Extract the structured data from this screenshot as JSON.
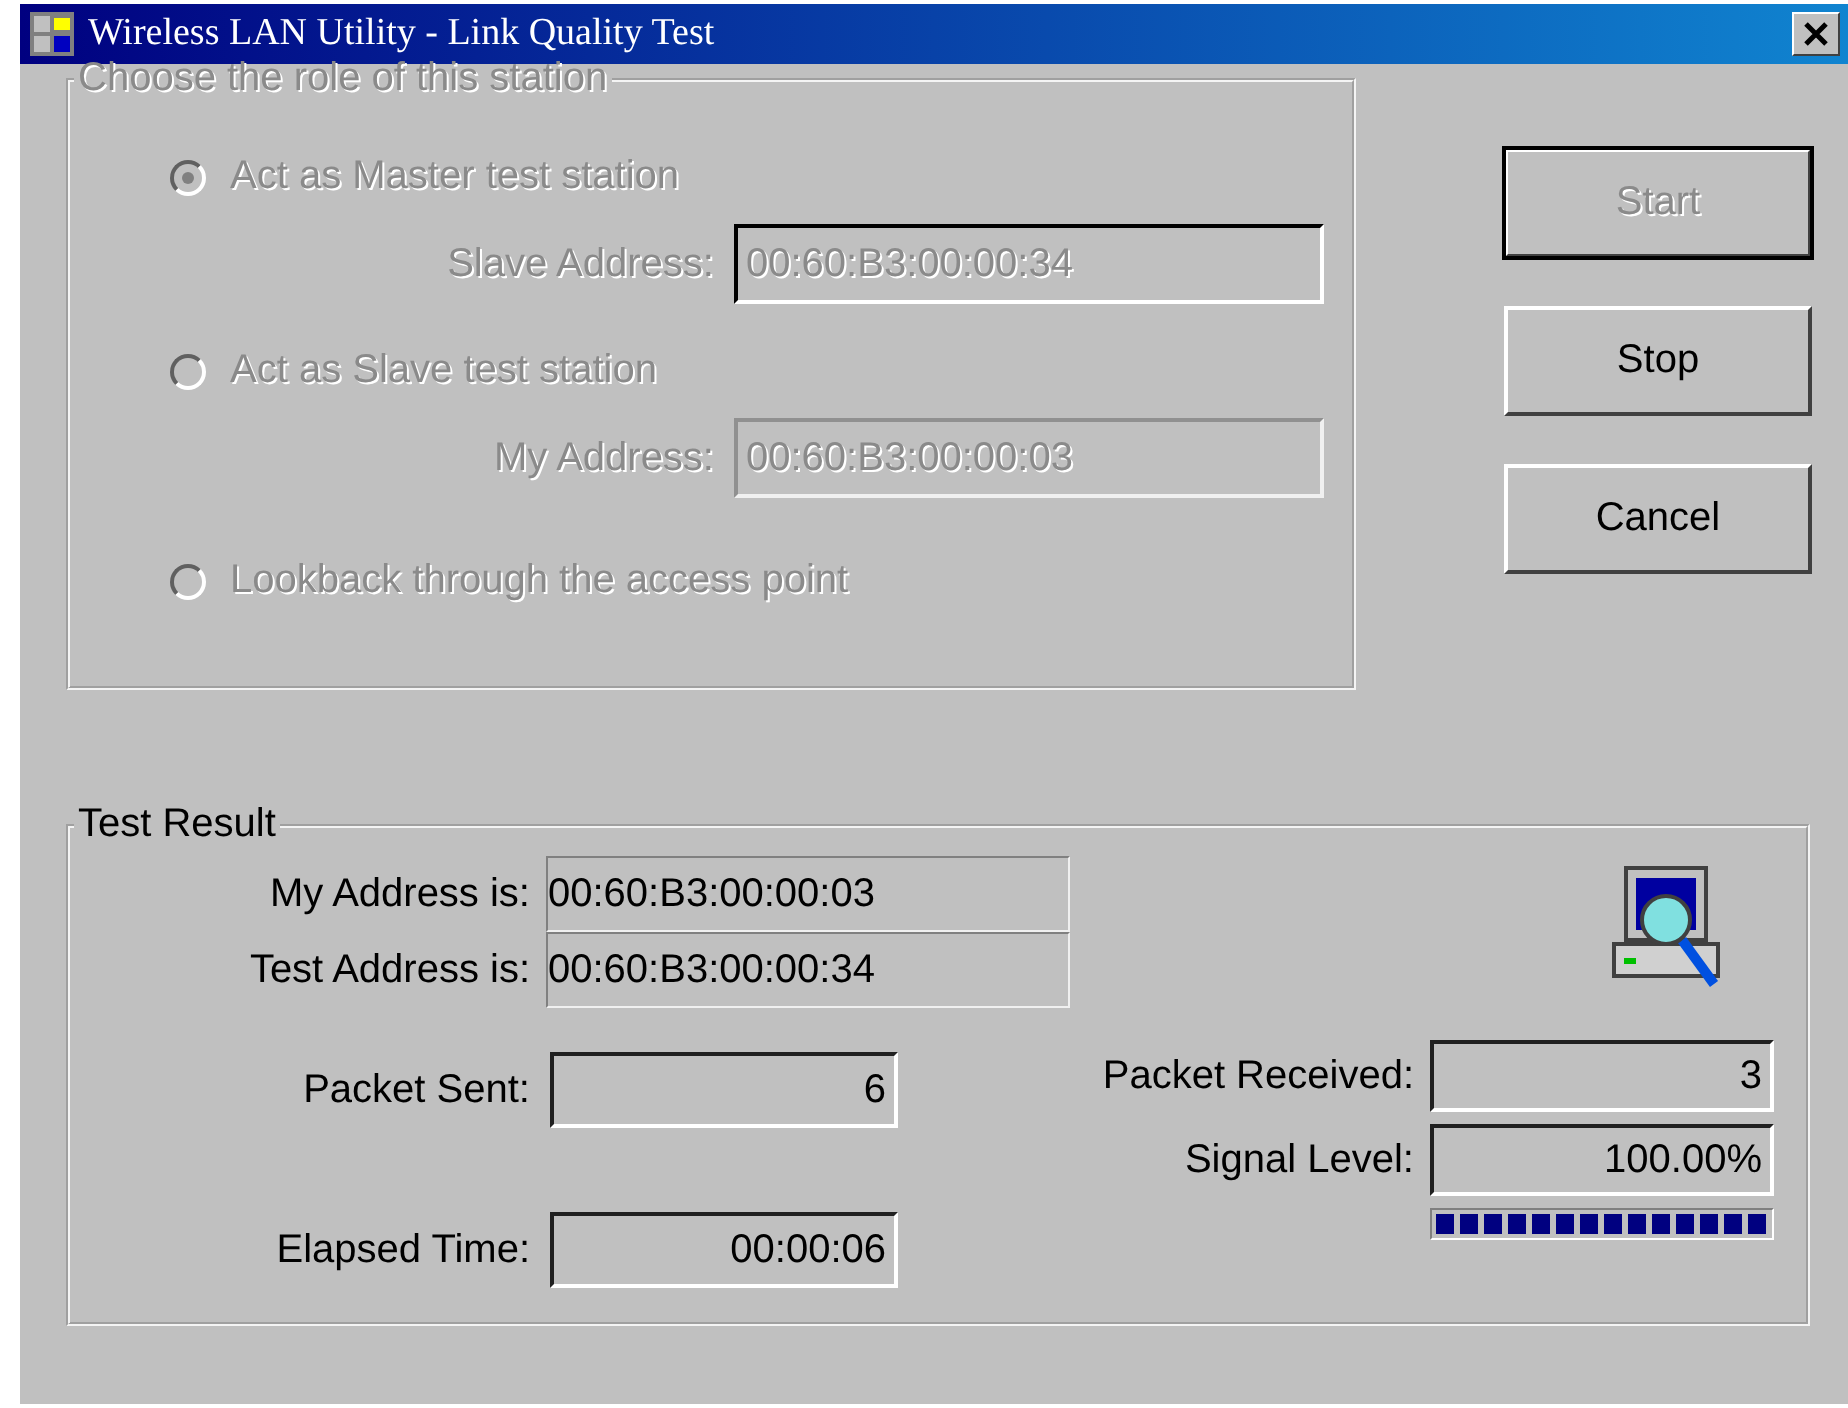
{
  "window": {
    "title": "Wireless LAN Utility - Link Quality Test"
  },
  "role_group": {
    "title": "Choose the role of this station",
    "disabled": true,
    "options": [
      {
        "label": "Act as Master test station",
        "selected": true,
        "field": {
          "label": "Slave Address:",
          "value": "00:60:B3:00:00:34",
          "focused": true
        }
      },
      {
        "label": "Act as Slave test station",
        "selected": false,
        "field": {
          "label": "My Address:",
          "value": "00:60:B3:00:00:03",
          "focused": false
        }
      },
      {
        "label": "Lookback through the access point",
        "selected": false
      }
    ]
  },
  "buttons": [
    {
      "label": "Start",
      "disabled": true,
      "default": true
    },
    {
      "label": "Stop",
      "disabled": false,
      "default": false
    },
    {
      "label": "Cancel",
      "disabled": false,
      "default": false
    }
  ],
  "result": {
    "title": "Test Result",
    "my_address": {
      "label": "My Address is:",
      "value": "00:60:B3:00:00:03"
    },
    "test_address": {
      "label": "Test Address is:",
      "value": "00:60:B3:00:00:34"
    },
    "packet_sent": {
      "label": "Packet Sent:",
      "value": "6"
    },
    "elapsed_time": {
      "label": "Elapsed Time:",
      "value": "00:00:06"
    },
    "packet_received": {
      "label": "Packet Received:",
      "value": "3"
    },
    "signal_level": {
      "label": "Signal Level:",
      "value": "100.00%",
      "level": 1
    }
  }
}
